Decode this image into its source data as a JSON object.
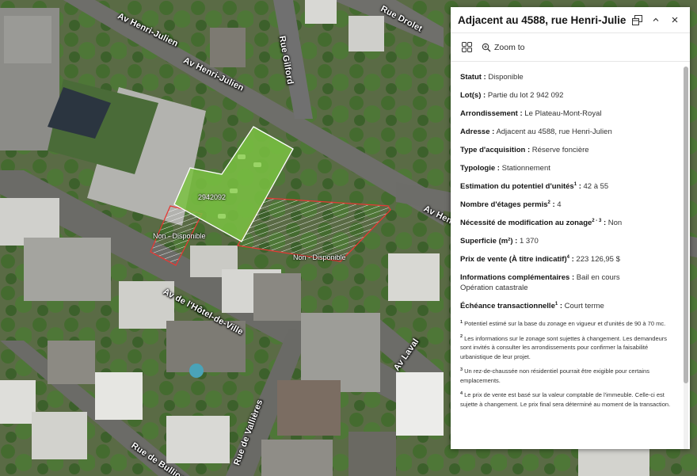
{
  "map": {
    "streets": {
      "henri_julien_top": "Av Henri-Julien",
      "henri_julien_mid": "Av Henri-Julien",
      "gilford": "Rue Gilford",
      "drolet": "Rue Drolet",
      "henri_julien_right": "Av Henri-",
      "hotel_de_ville": "Av de l'Hôtel-de-Ville",
      "laval": "Av Laval",
      "vallieres": "Rue de Vallières",
      "bullion": "Rue de Bullion"
    },
    "parcels": {
      "lot_number": "2942092",
      "non_dispo_left": "Non - Disponible",
      "non_dispo_right": "Non - Disponible"
    },
    "colors": {
      "selected_fill": "#7ac142",
      "selected_outline": "#ffffff",
      "unavailable_outline": "#e53935"
    }
  },
  "popup": {
    "title": "Adjacent au 4588, rue Henri-Julien",
    "icons": {
      "dock": "dock-icon",
      "collapse": "chevron-up-icon",
      "close": "close-icon",
      "grid": "grid-icon",
      "zoom": "zoom-search-icon"
    },
    "actions": {
      "zoom_to": "Zoom to"
    },
    "fields": {
      "statut": {
        "label": "Statut :",
        "value": "Disponible"
      },
      "lots": {
        "label": "Lot(s) :",
        "value": "Partie du lot 2 942 092"
      },
      "arrondissement": {
        "label": "Arrondissement :",
        "value": "Le Plateau-Mont-Royal"
      },
      "adresse": {
        "label": "Adresse :",
        "value": "Adjacent au 4588, rue Henri-Julien"
      },
      "type_acquisition": {
        "label": "Type d'acquisition :",
        "value": "Réserve foncière"
      },
      "typologie": {
        "label": "Typologie :",
        "value": "Stationnement"
      },
      "estimation": {
        "label": "Estimation du potentiel d'unités",
        "sup": "1",
        "colon": " :",
        "value": "42 à 55"
      },
      "etages": {
        "label": "Nombre d'étages permis",
        "sup": "2",
        "colon": " :",
        "value": "4"
      },
      "zonage": {
        "label": "Nécessité de modification au zonage",
        "sup": "2 - 3",
        "colon": " :",
        "value": "Non"
      },
      "superficie": {
        "label": "Superficie (m²) :",
        "value": "1 370"
      },
      "prix": {
        "label": "Prix de vente (À titre indicatif)",
        "sup": "4",
        "colon": " :",
        "value": "223 126,95 $"
      },
      "infos": {
        "label": "Informations complémentaires :",
        "value": "Bail en cours",
        "value2": "Opération catastrale"
      },
      "echeance": {
        "label": "Échéance transactionnelle",
        "sup": "1",
        "colon": " :",
        "value": "Court terme"
      }
    },
    "notes": [
      {
        "sup": "1",
        "text": "Potentiel estimé sur la base du zonage en vigueur et d'unités de 90 à 70 mc."
      },
      {
        "sup": "2",
        "text": "Les informations sur le zonage sont sujettes à changement. Les demandeurs sont invités à consulter les arrondissements pour confirmer la faisabilité urbanistique de leur projet."
      },
      {
        "sup": "3",
        "text": "Un rez-de-chaussée non résidentiel pourrait être exigible pour certains emplacements."
      },
      {
        "sup": "4",
        "text": "Le prix de vente est basé sur la valeur comptable de l'immeuble. Celle-ci est sujette à changement. Le prix final sera déterminé au moment de la transaction."
      }
    ]
  }
}
